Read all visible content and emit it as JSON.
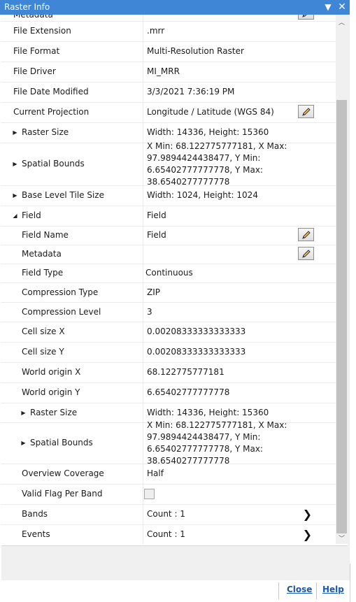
{
  "window": {
    "title": "Raster Info"
  },
  "titlebar": {
    "menu_icon": "dropdown-triangle",
    "close_icon": "close-x"
  },
  "rows": [
    {
      "name": "Metadata",
      "value": "",
      "indent": 0
    },
    {
      "name": "File Extension",
      "value": ".mrr",
      "indent": 0
    },
    {
      "name": "File Format",
      "value": "Multi-Resolution Raster",
      "indent": 0
    },
    {
      "name": "File Driver",
      "value": "MI_MRR",
      "indent": 0
    },
    {
      "name": "File Date Modified",
      "value": "3/3/2021 7:36:19 PM",
      "indent": 0
    },
    {
      "name": "Current Projection",
      "value": "Longitude / Latitude (WGS 84)",
      "indent": 0
    },
    {
      "name": "Raster Size",
      "value": "Width: 14336, Height: 15360",
      "indent": 0,
      "expander": "collapsed"
    },
    {
      "name": "Spatial Bounds",
      "value": "X Min: 68.122775777181, X Max: 97.9894424438477, Y Min: 6.65402777777778, Y Max: 38.6540277777778",
      "indent": 0,
      "expander": "collapsed"
    },
    {
      "name": "Base Level Tile Size",
      "value": "Width: 1024, Height: 1024",
      "indent": 0,
      "expander": "collapsed"
    },
    {
      "name": "Field",
      "value": "Field",
      "indent": 0,
      "expander": "expanded"
    },
    {
      "name": "Field Name",
      "value": "Field",
      "indent": 1
    },
    {
      "name": "Metadata",
      "value": "",
      "indent": 1
    },
    {
      "name": "Field Type",
      "value": "Continuous",
      "indent": 1
    },
    {
      "name": "Compression Type",
      "value": "ZIP",
      "indent": 1
    },
    {
      "name": "Compression Level",
      "value": "3",
      "indent": 1
    },
    {
      "name": "Cell size X",
      "value": "0.00208333333333333",
      "indent": 1
    },
    {
      "name": "Cell size Y",
      "value": "0.00208333333333333",
      "indent": 1
    },
    {
      "name": "World origin X",
      "value": "68.122775777181",
      "indent": 1
    },
    {
      "name": "World origin Y",
      "value": "6.65402777777778",
      "indent": 1
    },
    {
      "name": "Raster Size",
      "value": "Width: 14336, Height: 15360",
      "indent": 1,
      "expander": "collapsed"
    },
    {
      "name": "Spatial Bounds",
      "value": "X Min: 68.122775777181, X Max: 97.9894424438477, Y Min: 6.65402777777778, Y Max: 38.6540277777778",
      "indent": 1,
      "expander": "collapsed"
    },
    {
      "name": "Overview Coverage",
      "value": "Half",
      "indent": 1
    },
    {
      "name": "Valid Flag Per Band",
      "value": "",
      "indent": 1,
      "control": "checkbox",
      "checked": false
    },
    {
      "name": "Bands",
      "value": "Count : 1",
      "indent": 1,
      "control": "chevron"
    },
    {
      "name": "Events",
      "value": "Count : 1",
      "indent": 1,
      "control": "chevron"
    }
  ],
  "footer": {
    "close_label": "Close",
    "help_label": "Help"
  },
  "colors": {
    "title_bar": "#3f86d6",
    "link": "#1859b3",
    "grid_line": "#ebebeb",
    "scrollbar_thumb": "#c1c1c1"
  },
  "icons": {
    "edit": "pencil-icon",
    "expand": "triangle-right-icon",
    "collapse": "triangle-down-icon",
    "drill": "chevron-right-icon"
  }
}
